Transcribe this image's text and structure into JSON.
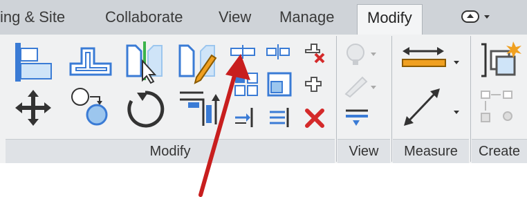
{
  "tabs": [
    {
      "label": "ing & Site"
    },
    {
      "label": "Collaborate"
    },
    {
      "label": "View"
    },
    {
      "label": "Manage"
    },
    {
      "label": "Modify",
      "active": true
    }
  ],
  "panels": {
    "modify": {
      "title": "Modify"
    },
    "view": {
      "title": "View"
    },
    "measure": {
      "title": "Measure"
    },
    "create": {
      "title": "Create"
    }
  },
  "colors": {
    "accent_blue": "#3a7bd5",
    "light_blue": "#9cc6ee",
    "orange": "#f0a020",
    "red": "#d42a2a",
    "arrow_red": "#c81e1e"
  },
  "icons": [
    "align-icon",
    "offset-icon",
    "mirror-pick-axis-icon",
    "mirror-draw-axis-icon",
    "split-element-icon",
    "split-with-gap-icon",
    "pin-icon",
    "move-icon",
    "copy-icon",
    "rotate-icon",
    "trim-extend-corner-icon",
    "array-icon",
    "scale-icon",
    "unpin-icon",
    "trim-extend-single-icon",
    "trim-extend-multiple-icon",
    "delete-icon",
    "override-graphics-icon",
    "paint-icon",
    "linework-icon",
    "aligned-dimension-icon",
    "measure-between-references-icon",
    "create-assembly-icon",
    "create-group-icon",
    "quick-access-toolbar-icon"
  ]
}
